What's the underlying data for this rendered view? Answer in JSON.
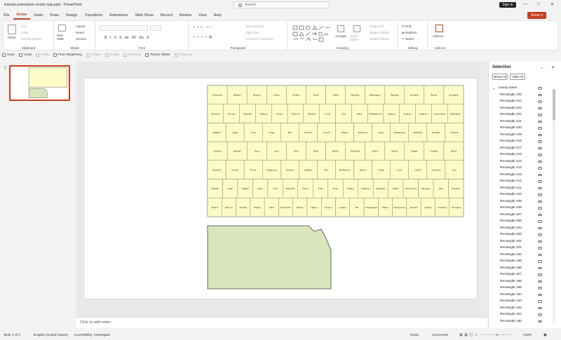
{
  "window": {
    "title": "Kansas powerpoint county map.pptx  -  PowerPoint",
    "search_placeholder": "Search",
    "signin": "Sign in",
    "share": "Share"
  },
  "menu": [
    "File",
    "Home",
    "Insert",
    "Draw",
    "Design",
    "Transitions",
    "Animations",
    "Slide Show",
    "Record",
    "Review",
    "View",
    "Help"
  ],
  "ribbon": {
    "groups": {
      "clipboard": "Clipboard",
      "slides": "Slides",
      "font": "Font",
      "paragraph": "Paragraph",
      "drawing": "Drawing",
      "editing": "Editing",
      "addins": "Add-ins"
    },
    "paste": "Paste",
    "cut": "Cut",
    "copy": "Copy",
    "format_painter": "Format Painter",
    "new_slide": "New Slide",
    "layout": "Layout",
    "reset": "Reset",
    "section": "Section",
    "text_direction": "Text Direction",
    "align_text": "Align Text",
    "convert_smartart": "Convert to SmartArt",
    "arrange": "Arrange",
    "quick_styles": "Quick Styles",
    "shape_fill": "Shape Fill",
    "shape_outline": "Shape Outline",
    "shape_effects": "Shape Effects",
    "find": "Find",
    "replace": "Replace",
    "select": "Select",
    "addins": "Add-ins"
  },
  "qat": [
    {
      "label": "Save",
      "enabled": true
    },
    {
      "label": "Undo",
      "enabled": true
    },
    {
      "label": "Redo",
      "enabled": false
    },
    {
      "label": "From Beginning",
      "enabled": true
    },
    {
      "label": "Delete",
      "enabled": false
    },
    {
      "label": "Group",
      "enabled": false
    },
    {
      "label": "Regroup",
      "enabled": false
    },
    {
      "label": "Reuse Slides",
      "enabled": true
    },
    {
      "label": "Ungroup",
      "enabled": false
    }
  ],
  "slides": {
    "current": "1"
  },
  "counties": [
    [
      "Cheyenne",
      "Rawlins",
      "Decatur",
      "Norton",
      "Phillips",
      "Smith",
      "Jewell",
      "Republic",
      "Washington",
      "Marshall",
      "Nemaha",
      "Brown",
      "Doniphan"
    ],
    [
      "Sherman",
      "Thomas",
      "Sheridan",
      "Graham",
      "Rooks",
      "Osborne",
      "Mitchell",
      "Cloud",
      "Clay",
      "Riley",
      "Pottawatomie",
      "Jackson",
      "Atchison",
      "Jefferson",
      "Leavenworth",
      "Wyandotte"
    ],
    [
      "Wallace",
      "Logan",
      "Gove",
      "Trego",
      "Ellis",
      "Russell",
      "Lincoln",
      "Ottawa",
      "Dickinson",
      "Geary",
      "Wabaunsee",
      "Shawnee",
      "Douglas",
      "Johnson"
    ],
    [
      "Greeley",
      "Wichita",
      "Scott",
      "Lane",
      "Ness",
      "Rush",
      "Barton",
      "Ellsworth",
      "Saline",
      "Morris",
      "Osage",
      "Franklin",
      "Miami"
    ],
    [
      "Hamilton",
      "Kearny",
      "Finney",
      "Hodgeman",
      "Pawnee",
      "Stafford",
      "Rice",
      "McPherson",
      "Marion",
      "Chase",
      "Lyon",
      "Coffey",
      "Anderson",
      "Linn"
    ],
    [
      "Stanton",
      "Grant",
      "Haskell",
      "Gray",
      "Ford",
      "Edwards",
      "Kiowa",
      "Pratt",
      "Reno",
      "Harvey",
      "Kingman",
      "Sedgwick",
      "Butler",
      "Greenwood",
      "Woodson",
      "Allen",
      "Bourbon"
    ],
    [
      "Morton",
      "Stevens",
      "Seward",
      "Meade",
      "Clark",
      "Comanche",
      "Barber",
      "Harper",
      "Sumner",
      "Cowley",
      "Elk",
      "Chautauqua",
      "Wilson",
      "Montgomery",
      "Neosho",
      "Labette",
      "Crawford",
      "Cherokee"
    ]
  ],
  "notes_placeholder": "Click to add notes",
  "selection": {
    "title": "Selection",
    "show_all": "Show All",
    "hide_all": "Hide All",
    "group": "county name",
    "items": [
      "Rectangle 225",
      "Rectangle 224",
      "Rectangle 223",
      "Rectangle 222",
      "Rectangle 221",
      "Rectangle 220",
      "Rectangle 219",
      "Rectangle 218",
      "Rectangle 217",
      "Rectangle 216",
      "Rectangle 215",
      "Rectangle 214",
      "Rectangle 213",
      "Rectangle 212",
      "Rectangle 211",
      "Rectangle 210",
      "Rectangle 209",
      "Rectangle 208",
      "Rectangle 207",
      "Rectangle 206",
      "Rectangle 204",
      "Rectangle 203",
      "Rectangle 202",
      "Rectangle 201",
      "Rectangle 200",
      "Rectangle 199",
      "Rectangle 198",
      "Rectangle 197",
      "Rectangle 196",
      "Rectangle 195",
      "Rectangle 194",
      "Rectangle 193",
      "Rectangle 192",
      "Rectangle 191",
      "Rectangle 190"
    ]
  },
  "status": {
    "slide": "Slide 1 of 1",
    "language": "English (United States)",
    "accessibility": "Accessibility: Investigate",
    "notes": "Notes",
    "comments": "Comments",
    "zoom": "146%"
  },
  "colors": {
    "accent": "#c43e1c",
    "county_fill": "#fbfcc6",
    "outline_fill": "#d9e5bc"
  }
}
